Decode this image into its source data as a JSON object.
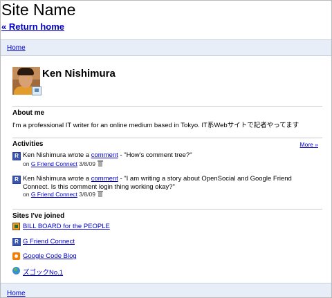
{
  "header": {
    "site_name": "Site Name",
    "return_home": "« Return home"
  },
  "top_bar": {
    "home_label": "Home"
  },
  "profile": {
    "name": "Ken Nishimura",
    "about_title": "About me",
    "about_text": "I'm a professional IT writer for an online medium based in Tokyo. IT系Webサイトで記者やってます"
  },
  "activities": {
    "title": "Activities",
    "more_label": "More »",
    "items": [
      {
        "actor": "Ken Nishimura wrote a ",
        "link": "comment",
        "text": " - \"How's comment tree?\"",
        "on": "on ",
        "source": "G Friend Connect",
        "date": " 3/8/09"
      },
      {
        "actor": "Ken Nishimura wrote a ",
        "link": "comment",
        "text": " - \"I am writing a story about OpenSocial and Google Friend Connect. Is this comment login thing working okay?\"",
        "on": "on ",
        "source": "G Friend Connect",
        "date": " 3/8/09"
      }
    ]
  },
  "sites": {
    "title": "Sites I've joined",
    "items": [
      {
        "label": "BILL BOARD for the PEOPLE",
        "icon": "billboard-icon"
      },
      {
        "label": "G Friend Connect",
        "icon": "r-icon"
      },
      {
        "label": "Google Code Blog",
        "icon": "blogger-icon"
      },
      {
        "label": "ズゴックNo.1",
        "icon": "globe-icon"
      }
    ]
  },
  "bottom_bar": {
    "home_label": "Home"
  },
  "colors": {
    "link": "#0000cc",
    "bar_bg": "#e8eef7",
    "divider": "#c9c9c9"
  }
}
